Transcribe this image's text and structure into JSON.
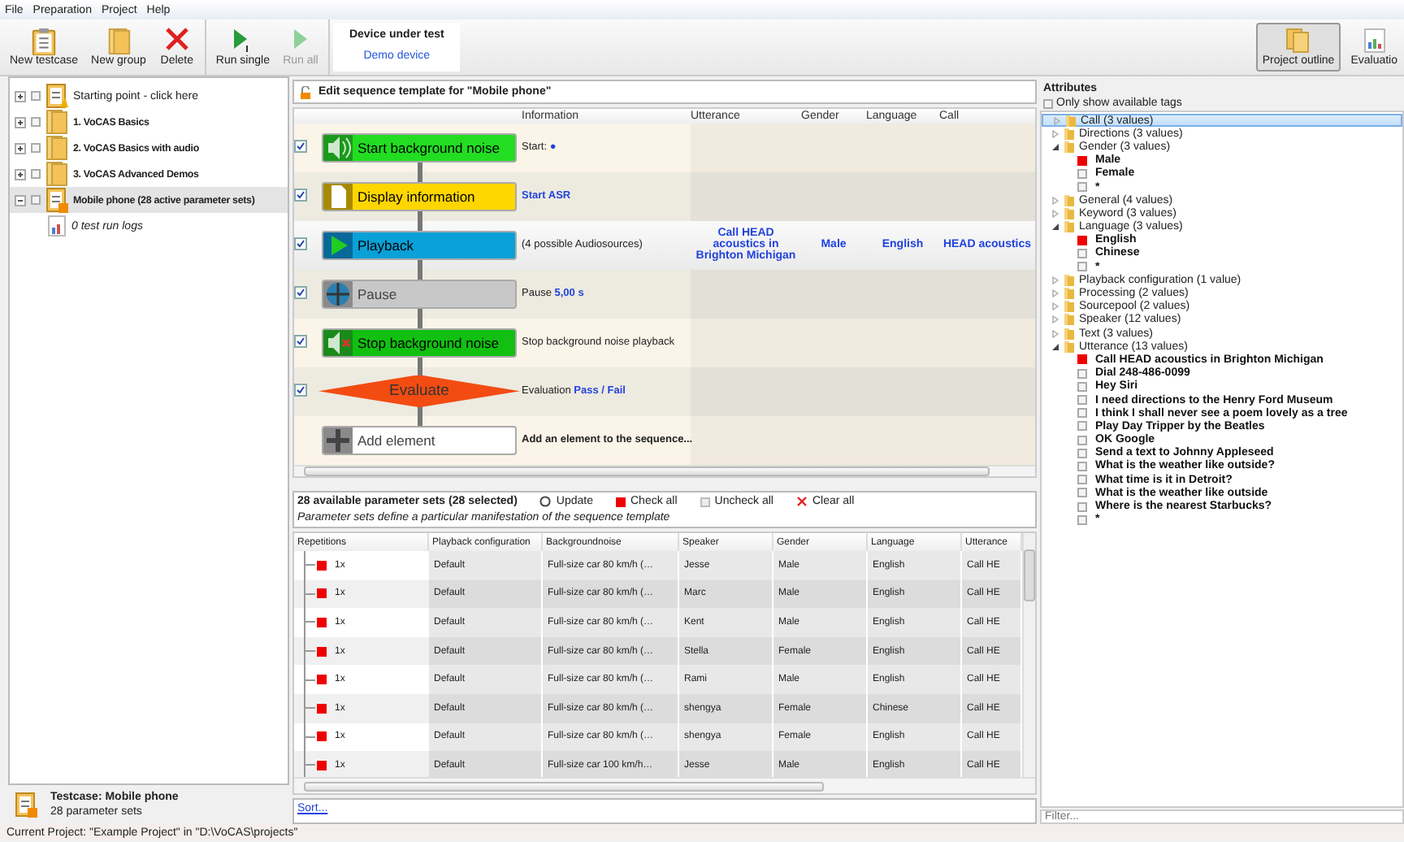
{
  "menu": [
    {
      "label": "File"
    },
    {
      "label": "Preparation"
    },
    {
      "label": "Project"
    },
    {
      "label": "Help"
    }
  ],
  "toolbar": {
    "groups": [
      [
        {
          "kind": "testcase",
          "label": "New testcase",
          "disabled": false
        },
        {
          "kind": "group",
          "label": "New group",
          "disabled": false
        },
        {
          "kind": "delete",
          "label": "Delete",
          "disabled": false
        }
      ],
      [
        {
          "kind": "run-single",
          "label": "Run single",
          "disabled": false
        },
        {
          "kind": "run-all",
          "label": "Run all",
          "disabled": true
        }
      ]
    ],
    "device": {
      "title": "Device under test",
      "value": "Demo device"
    },
    "views": [
      {
        "kind": "outline",
        "label": "Project outline",
        "selected": true
      },
      {
        "kind": "evaluation",
        "label": "Evaluatio",
        "selected": false
      }
    ]
  },
  "project_tree": {
    "items": [
      {
        "kind": "start",
        "label": "Starting point - click here",
        "selected": false
      },
      {
        "kind": "group",
        "label": "1. VoCAS Basics",
        "selected": false
      },
      {
        "kind": "group",
        "label": "2. VoCAS Basics with audio",
        "selected": false
      },
      {
        "kind": "group",
        "label": "3. VoCAS Advanced Demos",
        "selected": false
      },
      {
        "kind": "testcase",
        "label": "Mobile phone (28 active parameter sets)",
        "selected": true,
        "children": [
          {
            "kind": "logs",
            "label": "0 test run logs",
            "selected": false
          }
        ]
      }
    ]
  },
  "testcase_info": {
    "title": "Testcase: Mobile phone",
    "subtitle": "28 parameter sets"
  },
  "sequence": {
    "title": "Edit sequence template for \"Mobile phone\"",
    "columns": [
      "Information",
      "Utterance",
      "Gender",
      "Language",
      "Call"
    ],
    "steps": [
      {
        "kind": "noise-start",
        "label": "Start background noise",
        "checked": true,
        "selected": false,
        "info": "Start:",
        "value": "●"
      },
      {
        "kind": "display",
        "label": "Display information",
        "checked": true,
        "selected": false,
        "value": "Start ASR"
      },
      {
        "kind": "playback",
        "label": "Playback",
        "checked": true,
        "selected": true,
        "info": "(4 possible Audiosources)",
        "cells": [
          "Call HEAD acoustics in Brighton Michigan",
          "Male",
          "English",
          "HEAD acoustics"
        ]
      },
      {
        "kind": "pause",
        "label": "Pause",
        "checked": true,
        "selected": false,
        "info": "Pause",
        "value": "5,00 s"
      },
      {
        "kind": "noise-stop",
        "label": "Stop background noise",
        "checked": true,
        "selected": false,
        "info": "Stop background noise playback"
      },
      {
        "kind": "evaluate",
        "label": "Evaluate",
        "checked": true,
        "selected": false,
        "info": "Evaluation",
        "value": "Pass / Fail"
      },
      {
        "kind": "add",
        "label": "Add element",
        "info": "Add an element to the sequence..."
      }
    ]
  },
  "parameter_sets": {
    "summary": "28 available parameter sets (28 selected)",
    "actions": [
      {
        "kind": "update",
        "label": "Update"
      },
      {
        "kind": "check",
        "label": "Check all"
      },
      {
        "kind": "uncheck",
        "label": "Uncheck all"
      },
      {
        "kind": "clear",
        "label": "Clear all"
      }
    ],
    "note": "Parameter sets define a particular manifestation of the sequence template",
    "columns": [
      "Repetitions",
      "Playback configuration",
      "Backgroundnoise",
      "Speaker",
      "Gender",
      "Language",
      "Utterance"
    ],
    "rows": [
      {
        "checked": true,
        "cells": [
          "1x",
          "Default",
          "Full-size car 80 km/h (…",
          "Jesse",
          "Male",
          "English",
          "Call HE"
        ]
      },
      {
        "checked": true,
        "cells": [
          "1x",
          "Default",
          "Full-size car 80 km/h (…",
          "Marc",
          "Male",
          "English",
          "Call HE"
        ]
      },
      {
        "checked": true,
        "cells": [
          "1x",
          "Default",
          "Full-size car 80 km/h (…",
          "Kent",
          "Male",
          "English",
          "Call HE"
        ]
      },
      {
        "checked": true,
        "cells": [
          "1x",
          "Default",
          "Full-size car 80 km/h (…",
          "Stella",
          "Female",
          "English",
          "Call HE"
        ]
      },
      {
        "checked": true,
        "cells": [
          "1x",
          "Default",
          "Full-size car 80 km/h (…",
          "Rami",
          "Male",
          "English",
          "Call HE"
        ]
      },
      {
        "checked": true,
        "cells": [
          "1x",
          "Default",
          "Full-size car 80 km/h (…",
          "shengya",
          "Female",
          "Chinese",
          "Call HE"
        ]
      },
      {
        "checked": true,
        "cells": [
          "1x",
          "Default",
          "Full-size car 80 km/h (…",
          "shengya",
          "Female",
          "English",
          "Call HE"
        ]
      },
      {
        "checked": true,
        "cells": [
          "1x",
          "Default",
          "Full-size car 100 km/h…",
          "Jesse",
          "Male",
          "English",
          "Call HE"
        ]
      }
    ],
    "sort_link": "Sort..."
  },
  "attributes": {
    "title": "Attributes",
    "filter_checkbox": {
      "label": "Only show available tags",
      "checked": false
    },
    "categories": [
      {
        "label": "Call (3 values)",
        "expanded": false,
        "selected": true
      },
      {
        "label": "Directions (3 values)",
        "expanded": false,
        "selected": false
      },
      {
        "label": "Gender (3 values)",
        "expanded": true,
        "selected": false,
        "children": [
          {
            "label": "Male",
            "checked": true
          },
          {
            "label": "Female",
            "checked": false
          },
          {
            "label": "*",
            "checked": false
          }
        ]
      },
      {
        "label": "General (4 values)",
        "expanded": false,
        "selected": false
      },
      {
        "label": "Keyword (3 values)",
        "expanded": false,
        "selected": false
      },
      {
        "label": "Language (3 values)",
        "expanded": true,
        "selected": false,
        "children": [
          {
            "label": "English",
            "checked": true
          },
          {
            "label": "Chinese",
            "checked": false
          },
          {
            "label": "*",
            "checked": false
          }
        ]
      },
      {
        "label": "Playback configuration (1 value)",
        "expanded": false,
        "selected": false
      },
      {
        "label": "Processing (2 values)",
        "expanded": false,
        "selected": false
      },
      {
        "label": "Sourcepool (2 values)",
        "expanded": false,
        "selected": false
      },
      {
        "label": "Speaker (12 values)",
        "expanded": false,
        "selected": false
      },
      {
        "label": "Text (3 values)",
        "expanded": false,
        "selected": false
      },
      {
        "label": "Utterance (13 values)",
        "expanded": true,
        "selected": false,
        "children": [
          {
            "label": "Call HEAD acoustics in Brighton Michigan",
            "checked": true
          },
          {
            "label": "Dial 248-486-0099",
            "checked": false
          },
          {
            "label": "Hey Siri",
            "checked": false
          },
          {
            "label": "I need directions to the Henry Ford Museum",
            "checked": false
          },
          {
            "label": "I think I shall never see a poem lovely as a tree",
            "checked": false
          },
          {
            "label": "Play Day Tripper by the Beatles",
            "checked": false
          },
          {
            "label": "OK Google",
            "checked": false
          },
          {
            "label": "Send a text to Johnny Appleseed",
            "checked": false
          },
          {
            "label": "What is the weather like outside?",
            "checked": false
          },
          {
            "label": "What time is it in Detroit?",
            "checked": false
          },
          {
            "label": "What is the weather like outside",
            "checked": false
          },
          {
            "label": "Where is the nearest Starbucks?",
            "checked": false
          },
          {
            "label": "*",
            "checked": false
          }
        ]
      }
    ],
    "filter": {
      "placeholder": "Filter..."
    }
  },
  "status_bar": "Current Project: \"Example Project\" in \"D:\\VoCAS\\projects\""
}
